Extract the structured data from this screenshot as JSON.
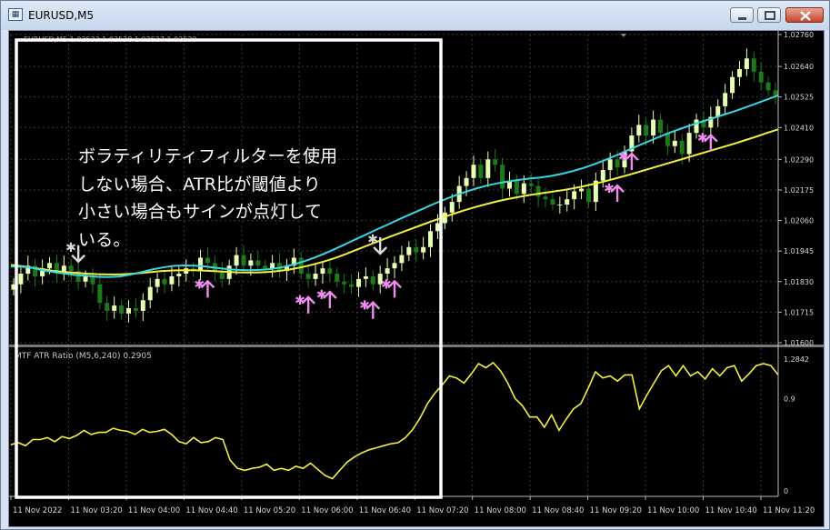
{
  "window": {
    "title": "EURUSD,M5",
    "icon": "chart-window-icon",
    "buttons": [
      "minimize-icon",
      "maximize-icon",
      "close-icon"
    ]
  },
  "indicator_header": "EURUSD,M5  1.02533 1.02538 1.02527 1.02530",
  "sub_window_label": "MTF ATR Ratio  (M5,6,240) 0.2905",
  "price_axis": [
    "1.02760",
    "1.02640",
    "1.02525",
    "1.02410",
    "1.02290",
    "1.02175",
    "1.02060",
    "1.01945",
    "1.01830",
    "1.01715",
    "1.01600"
  ],
  "sub_axis": [
    "1.2842",
    "0.9",
    "0"
  ],
  "time_axis": [
    "11 Nov 2022",
    "11 Nov 03:20",
    "11 Nov 04:00",
    "11 Nov 04:40",
    "11 Nov 05:20",
    "11 Nov 06:00",
    "11 Nov 06:40",
    "11 Nov 07:20",
    "11 Nov 08:00",
    "11 Nov 08:40",
    "11 Nov 09:20",
    "11 Nov 10:00",
    "11 Nov 10:40",
    "11 Nov 11:20"
  ],
  "callout_lines": [
    "ボラティリティフィルターを使用",
    "しない場合、ATR比が閾値より",
    "小さい場合もサインが点灯して",
    "いる。"
  ],
  "colors": {
    "background": "#000000",
    "grid": "#3a3a3a",
    "bull_candle": "#e6ffb3",
    "bear_candle": "#1c7a1c",
    "fast_ma": "#36d6e7",
    "slow_ma": "#f5f03c",
    "atr_ratio": "#f5f03c",
    "arrow_buy": "#f08cf0",
    "arrow_sell": "#d8d8d8",
    "highlight_box": "#ffffff"
  },
  "chart_data": {
    "type": "candlestick",
    "symbol": "EURUSD",
    "timeframe": "M5",
    "ylim": [
      1.016,
      1.0276
    ],
    "close": [
      1.0182,
      1.0186,
      1.0189,
      1.0185,
      1.0188,
      1.019,
      1.0186,
      1.0189,
      1.0187,
      1.0183,
      1.0185,
      1.0182,
      1.0175,
      1.0172,
      1.0174,
      1.0171,
      1.0173,
      1.0172,
      1.0176,
      1.0181,
      1.0184,
      1.0182,
      1.0185,
      1.0186,
      1.0188,
      1.0187,
      1.0192,
      1.019,
      1.0187,
      1.0184,
      1.0189,
      1.0193,
      1.0189,
      1.0191,
      1.0189,
      1.0188,
      1.019,
      1.0187,
      1.0189,
      1.0192,
      1.0186,
      1.0184,
      1.0186,
      1.0188,
      1.0186,
      1.0183,
      1.0182,
      1.0181,
      1.0184,
      1.0185,
      1.0182,
      1.0186,
      1.0188,
      1.019,
      1.0193,
      1.0196,
      1.0194,
      1.0196,
      1.0202,
      1.0205,
      1.0209,
      1.0213,
      1.0219,
      1.0222,
      1.0227,
      1.0222,
      1.0229,
      1.0227,
      1.0218,
      1.0221,
      1.0216,
      1.022,
      1.0219,
      1.0215,
      1.0214,
      1.0212,
      1.0212,
      1.0214,
      1.0217,
      1.0218,
      1.0213,
      1.0221,
      1.0225,
      1.0229,
      1.0226,
      1.0232,
      1.0238,
      1.0242,
      1.0238,
      1.0244,
      1.0239,
      1.0234,
      1.0236,
      1.0231,
      1.0239,
      1.0244,
      1.0241,
      1.0245,
      1.0249,
      1.0254,
      1.026,
      1.0263,
      1.0267,
      1.0262,
      1.0258,
      1.0255,
      1.0253
    ],
    "fast_ma": [
      1.01887,
      1.01886,
      1.01882,
      1.01872,
      1.01866,
      1.0186,
      1.01855,
      1.01852,
      1.01848,
      1.01847,
      1.01849,
      1.01856,
      1.01865,
      1.01875,
      1.01883,
      1.01889,
      1.01891,
      1.0189,
      1.01887,
      1.01882,
      1.01877,
      1.01874,
      1.01873,
      1.01874,
      1.01877,
      1.01883,
      1.01893,
      1.01905,
      1.01919,
      1.01935,
      1.01953,
      1.01972,
      1.01991,
      1.0201,
      1.02029,
      1.02047,
      1.02066,
      1.02084,
      1.02102,
      1.0212,
      1.02137,
      1.02153,
      1.02167,
      1.0218,
      1.02191,
      1.022,
      1.02207,
      1.02213,
      1.02218,
      1.02222,
      1.02228,
      1.02236,
      1.02246,
      1.02258,
      1.02272,
      1.02288,
      1.02305,
      1.02323,
      1.02341,
      1.02358,
      1.02375,
      1.02391,
      1.02406,
      1.0242,
      1.02433,
      1.02446,
      1.02459,
      1.02472,
      1.02486,
      1.02501,
      1.02516,
      1.02531
    ],
    "slow_ma": [
      1.01893,
      1.01888,
      1.01882,
      1.01876,
      1.0187,
      1.01866,
      1.01863,
      1.0186,
      1.01858,
      1.01857,
      1.01857,
      1.01859,
      1.01862,
      1.01866,
      1.0187,
      1.01872,
      1.01873,
      1.01873,
      1.01871,
      1.01869,
      1.01867,
      1.01865,
      1.01864,
      1.01865,
      1.01867,
      1.01871,
      1.01877,
      1.01885,
      1.01895,
      1.01906,
      1.01919,
      1.01934,
      1.0195,
      1.01966,
      1.01982,
      1.01998,
      1.02013,
      1.02028,
      1.02043,
      1.02058,
      1.02072,
      1.02086,
      1.02099,
      1.02111,
      1.02122,
      1.02132,
      1.02141,
      1.02149,
      1.02156,
      1.02162,
      1.02168,
      1.02174,
      1.02181,
      1.02189,
      1.02198,
      1.02208,
      1.02219,
      1.0223,
      1.02242,
      1.02254,
      1.02266,
      1.02278,
      1.0229,
      1.02302,
      1.02314,
      1.02326,
      1.02338,
      1.0235,
      1.02363,
      1.02376,
      1.0239,
      1.02403
    ],
    "atr_ratio": [
      0.45,
      0.47,
      0.44,
      0.5,
      0.5,
      0.52,
      0.48,
      0.53,
      0.51,
      0.54,
      0.59,
      0.55,
      0.57,
      0.57,
      0.61,
      0.59,
      0.58,
      0.55,
      0.6,
      0.57,
      0.58,
      0.6,
      0.55,
      0.48,
      0.46,
      0.52,
      0.47,
      0.48,
      0.52,
      0.5,
      0.3,
      0.22,
      0.2,
      0.22,
      0.23,
      0.26,
      0.2,
      0.22,
      0.2,
      0.24,
      0.22,
      0.27,
      0.21,
      0.15,
      0.12,
      0.2,
      0.28,
      0.33,
      0.37,
      0.4,
      0.42,
      0.44,
      0.46,
      0.47,
      0.52,
      0.6,
      0.71,
      0.85,
      0.95,
      1.03,
      1.12,
      1.1,
      1.05,
      1.14,
      1.24,
      1.2,
      1.25,
      1.17,
      1.05,
      0.9,
      0.83,
      0.72,
      0.72,
      0.62,
      0.74,
      0.59,
      0.7,
      0.8,
      0.85,
      1.0,
      1.16,
      1.1,
      1.12,
      1.07,
      1.13,
      1.13,
      0.8,
      0.93,
      1.05,
      1.17,
      1.22,
      1.12,
      1.22,
      1.12,
      1.16,
      1.09,
      1.19,
      1.12,
      1.2,
      1.22,
      1.07,
      1.14,
      1.22,
      1.24,
      1.22,
      1.13
    ],
    "buy_signal_bars": [
      27,
      41,
      44,
      50,
      53,
      84,
      86,
      97
    ],
    "sell_signal_bars": [
      9,
      51
    ]
  }
}
